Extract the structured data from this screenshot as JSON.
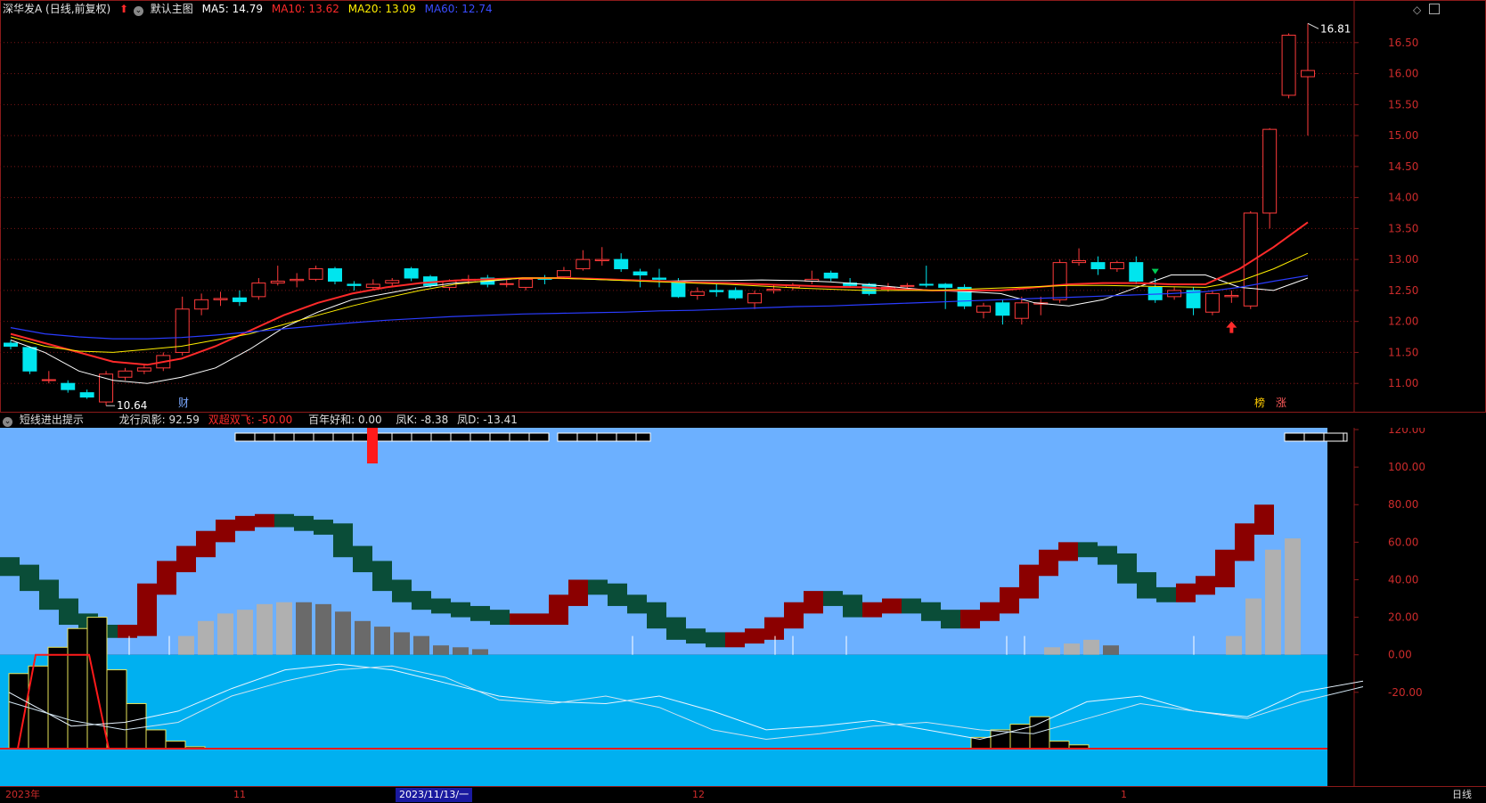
{
  "main_header": {
    "title": "深华发A (日线,前复权)",
    "default_chart": "默认主图",
    "ma5": "MA5: 14.79",
    "ma10": "MA10: 13.62",
    "ma20": "MA20: 13.09",
    "ma60": "MA60: 12.74"
  },
  "sub_header": {
    "title": "短线进出提示",
    "dragon": "龙行凤影: 92.59",
    "double_fly": "双超双飞: -50.00",
    "hundred": "百年好和: 0.00",
    "phoenix_k": "凤K: -8.38",
    "phoenix_d": "凤D: -13.41"
  },
  "markers": {
    "high_label": "16.81",
    "low_label": "10.64",
    "cai": "财",
    "bang": "榜",
    "zhang": "涨"
  },
  "price_axis": [
    "16.50",
    "16.00",
    "15.50",
    "15.00",
    "14.50",
    "14.00",
    "13.50",
    "13.00",
    "12.50",
    "12.00",
    "11.50",
    "11.00"
  ],
  "indicator_axis": [
    "120.00",
    "100.00",
    "80.00",
    "60.00",
    "40.00",
    "20.00",
    "0.00",
    "-20.00"
  ],
  "bottom_bar": {
    "year": "2023年",
    "m11": "11",
    "cursor_date": "2023/11/13/一",
    "m12": "12",
    "m1": "1",
    "period": "日线"
  },
  "colors": {
    "up": "#ff3b3b",
    "down": "#00e5ee",
    "ma5": "#ffffff",
    "ma10": "#ff2a2a",
    "ma20": "#ffee00",
    "ma60": "#2a3cff",
    "ind_bg": "#6cb0ff",
    "ind_bottom": "#00b0f0",
    "band_up": "#8b0000",
    "band_down": "#0a4d38"
  },
  "chart_data": {
    "type": "candlestick",
    "title": "深华发A (日线,前复权)",
    "ylim": [
      10.6,
      16.9
    ],
    "candles": [
      {
        "o": 11.65,
        "c": 11.6,
        "h": 11.7,
        "l": 11.55
      },
      {
        "o": 11.58,
        "c": 11.2,
        "h": 11.6,
        "l": 11.15
      },
      {
        "o": 11.05,
        "c": 11.06,
        "h": 11.2,
        "l": 11.0
      },
      {
        "o": 11.0,
        "c": 10.9,
        "h": 11.05,
        "l": 10.85
      },
      {
        "o": 10.85,
        "c": 10.78,
        "h": 10.9,
        "l": 10.75
      },
      {
        "o": 10.7,
        "c": 11.15,
        "h": 11.2,
        "l": 10.64
      },
      {
        "o": 11.1,
        "c": 11.2,
        "h": 11.25,
        "l": 11.05
      },
      {
        "o": 11.2,
        "c": 11.25,
        "h": 11.3,
        "l": 11.15
      },
      {
        "o": 11.25,
        "c": 11.45,
        "h": 11.5,
        "l": 11.2
      },
      {
        "o": 11.5,
        "c": 12.2,
        "h": 12.4,
        "l": 11.45
      },
      {
        "o": 12.2,
        "c": 12.35,
        "h": 12.45,
        "l": 12.1
      },
      {
        "o": 12.35,
        "c": 12.37,
        "h": 12.48,
        "l": 12.25
      },
      {
        "o": 12.38,
        "c": 12.32,
        "h": 12.5,
        "l": 12.25
      },
      {
        "o": 12.4,
        "c": 12.62,
        "h": 12.7,
        "l": 12.35
      },
      {
        "o": 12.62,
        "c": 12.65,
        "h": 12.9,
        "l": 12.58
      },
      {
        "o": 12.66,
        "c": 12.68,
        "h": 12.78,
        "l": 12.55
      },
      {
        "o": 12.68,
        "c": 12.85,
        "h": 12.9,
        "l": 12.65
      },
      {
        "o": 12.85,
        "c": 12.65,
        "h": 12.88,
        "l": 12.6
      },
      {
        "o": 12.6,
        "c": 12.58,
        "h": 12.65,
        "l": 12.5
      },
      {
        "o": 12.55,
        "c": 12.6,
        "h": 12.68,
        "l": 12.5
      },
      {
        "o": 12.62,
        "c": 12.66,
        "h": 12.7,
        "l": 12.55
      },
      {
        "o": 12.85,
        "c": 12.7,
        "h": 12.88,
        "l": 12.65
      },
      {
        "o": 12.72,
        "c": 12.58,
        "h": 12.75,
        "l": 12.55
      },
      {
        "o": 12.55,
        "c": 12.65,
        "h": 12.68,
        "l": 12.5
      },
      {
        "o": 12.66,
        "c": 12.68,
        "h": 12.75,
        "l": 12.6
      },
      {
        "o": 12.7,
        "c": 12.6,
        "h": 12.75,
        "l": 12.55
      },
      {
        "o": 12.6,
        "c": 12.61,
        "h": 12.68,
        "l": 12.55
      },
      {
        "o": 12.55,
        "c": 12.68,
        "h": 12.7,
        "l": 12.5
      },
      {
        "o": 12.7,
        "c": 12.68,
        "h": 12.75,
        "l": 12.6
      },
      {
        "o": 12.72,
        "c": 12.82,
        "h": 12.88,
        "l": 12.7
      },
      {
        "o": 12.85,
        "c": 13.0,
        "h": 13.15,
        "l": 12.82
      },
      {
        "o": 12.98,
        "c": 13.0,
        "h": 13.2,
        "l": 12.9
      },
      {
        "o": 13.0,
        "c": 12.85,
        "h": 13.1,
        "l": 12.8
      },
      {
        "o": 12.8,
        "c": 12.75,
        "h": 12.85,
        "l": 12.55
      },
      {
        "o": 12.7,
        "c": 12.68,
        "h": 12.85,
        "l": 12.55
      },
      {
        "o": 12.65,
        "c": 12.4,
        "h": 12.7,
        "l": 12.38
      },
      {
        "o": 12.42,
        "c": 12.48,
        "h": 12.55,
        "l": 12.35
      },
      {
        "o": 12.5,
        "c": 12.48,
        "h": 12.6,
        "l": 12.4
      },
      {
        "o": 12.5,
        "c": 12.38,
        "h": 12.55,
        "l": 12.35
      },
      {
        "o": 12.3,
        "c": 12.45,
        "h": 12.5,
        "l": 12.2
      },
      {
        "o": 12.5,
        "c": 12.52,
        "h": 12.6,
        "l": 12.45
      },
      {
        "o": 12.55,
        "c": 12.58,
        "h": 12.62,
        "l": 12.5
      },
      {
        "o": 12.65,
        "c": 12.68,
        "h": 12.82,
        "l": 12.6
      },
      {
        "o": 12.78,
        "c": 12.7,
        "h": 12.82,
        "l": 12.65
      },
      {
        "o": 12.62,
        "c": 12.58,
        "h": 12.7,
        "l": 12.55
      },
      {
        "o": 12.6,
        "c": 12.45,
        "h": 12.62,
        "l": 12.42
      },
      {
        "o": 12.52,
        "c": 12.55,
        "h": 12.62,
        "l": 12.48
      },
      {
        "o": 12.58,
        "c": 12.58,
        "h": 12.62,
        "l": 12.5
      },
      {
        "o": 12.6,
        "c": 12.59,
        "h": 12.9,
        "l": 12.55
      },
      {
        "o": 12.6,
        "c": 12.55,
        "h": 12.62,
        "l": 12.2
      },
      {
        "o": 12.55,
        "c": 12.25,
        "h": 12.6,
        "l": 12.2
      },
      {
        "o": 12.15,
        "c": 12.25,
        "h": 12.3,
        "l": 12.05
      },
      {
        "o": 12.3,
        "c": 12.1,
        "h": 12.35,
        "l": 11.95
      },
      {
        "o": 12.05,
        "c": 12.3,
        "h": 12.4,
        "l": 11.95
      },
      {
        "o": 12.28,
        "c": 12.3,
        "h": 12.4,
        "l": 12.1
      },
      {
        "o": 12.35,
        "c": 12.95,
        "h": 13.0,
        "l": 12.3
      },
      {
        "o": 12.95,
        "c": 12.98,
        "h": 13.18,
        "l": 12.9
      },
      {
        "o": 12.95,
        "c": 12.85,
        "h": 13.05,
        "l": 12.75
      },
      {
        "o": 12.85,
        "c": 12.95,
        "h": 12.98,
        "l": 12.8
      },
      {
        "o": 12.95,
        "c": 12.65,
        "h": 13.05,
        "l": 12.6
      },
      {
        "o": 12.55,
        "c": 12.35,
        "h": 12.7,
        "l": 12.3
      },
      {
        "o": 12.4,
        "c": 12.5,
        "h": 12.55,
        "l": 12.35
      },
      {
        "o": 12.5,
        "c": 12.22,
        "h": 12.55,
        "l": 12.1
      },
      {
        "o": 12.15,
        "c": 12.45,
        "h": 12.5,
        "l": 12.1
      },
      {
        "o": 12.4,
        "c": 12.42,
        "h": 12.5,
        "l": 12.3
      },
      {
        "o": 12.25,
        "c": 13.75,
        "h": 13.78,
        "l": 12.2
      },
      {
        "o": 13.75,
        "c": 15.1,
        "h": 15.12,
        "l": 13.5
      },
      {
        "o": 15.65,
        "c": 16.62,
        "h": 16.65,
        "l": 15.6
      },
      {
        "o": 15.95,
        "c": 16.05,
        "h": 16.81,
        "l": 15.0
      }
    ],
    "ma": {
      "MA5": [
        11.7,
        11.5,
        11.2,
        11.05,
        11.0,
        11.1,
        11.25,
        11.55,
        11.9,
        12.15,
        12.35,
        12.45,
        12.55,
        12.62,
        12.65,
        12.7,
        12.7,
        12.68,
        12.66,
        12.65,
        12.66,
        12.66,
        12.67,
        12.66,
        12.64,
        12.6,
        12.55,
        12.5,
        12.48,
        12.45,
        12.3,
        12.25,
        12.35,
        12.55,
        12.75,
        12.75,
        12.55,
        12.5,
        12.7
      ],
      "MA10": [
        11.8,
        11.65,
        11.5,
        11.35,
        11.3,
        11.4,
        11.6,
        11.85,
        12.1,
        12.3,
        12.45,
        12.55,
        12.62,
        12.66,
        12.68,
        12.7,
        12.7,
        12.69,
        12.67,
        12.65,
        12.63,
        12.62,
        12.6,
        12.58,
        12.56,
        12.55,
        12.52,
        12.5,
        12.5,
        12.5,
        12.55,
        12.6,
        12.62,
        12.62,
        12.6,
        12.6,
        12.85,
        13.2,
        13.6
      ],
      "MA20": [
        11.75,
        11.6,
        11.52,
        11.5,
        11.55,
        11.6,
        11.7,
        11.8,
        11.95,
        12.1,
        12.25,
        12.38,
        12.5,
        12.6,
        12.66,
        12.7,
        12.7,
        12.68,
        12.66,
        12.64,
        12.62,
        12.6,
        12.57,
        12.54,
        12.52,
        12.5,
        12.5,
        12.5,
        12.52,
        12.54,
        12.56,
        12.58,
        12.58,
        12.57,
        12.56,
        12.55,
        12.65,
        12.85,
        13.1
      ],
      "MA60": [
        11.9,
        11.8,
        11.75,
        11.72,
        11.72,
        11.74,
        11.78,
        11.83,
        11.88,
        11.93,
        11.98,
        12.02,
        12.05,
        12.08,
        12.1,
        12.12,
        12.13,
        12.14,
        12.15,
        12.17,
        12.18,
        12.2,
        12.22,
        12.24,
        12.25,
        12.27,
        12.29,
        12.31,
        12.33,
        12.35,
        12.37,
        12.39,
        12.41,
        12.43,
        12.45,
        12.48,
        12.55,
        12.65,
        12.74
      ]
    }
  }
}
